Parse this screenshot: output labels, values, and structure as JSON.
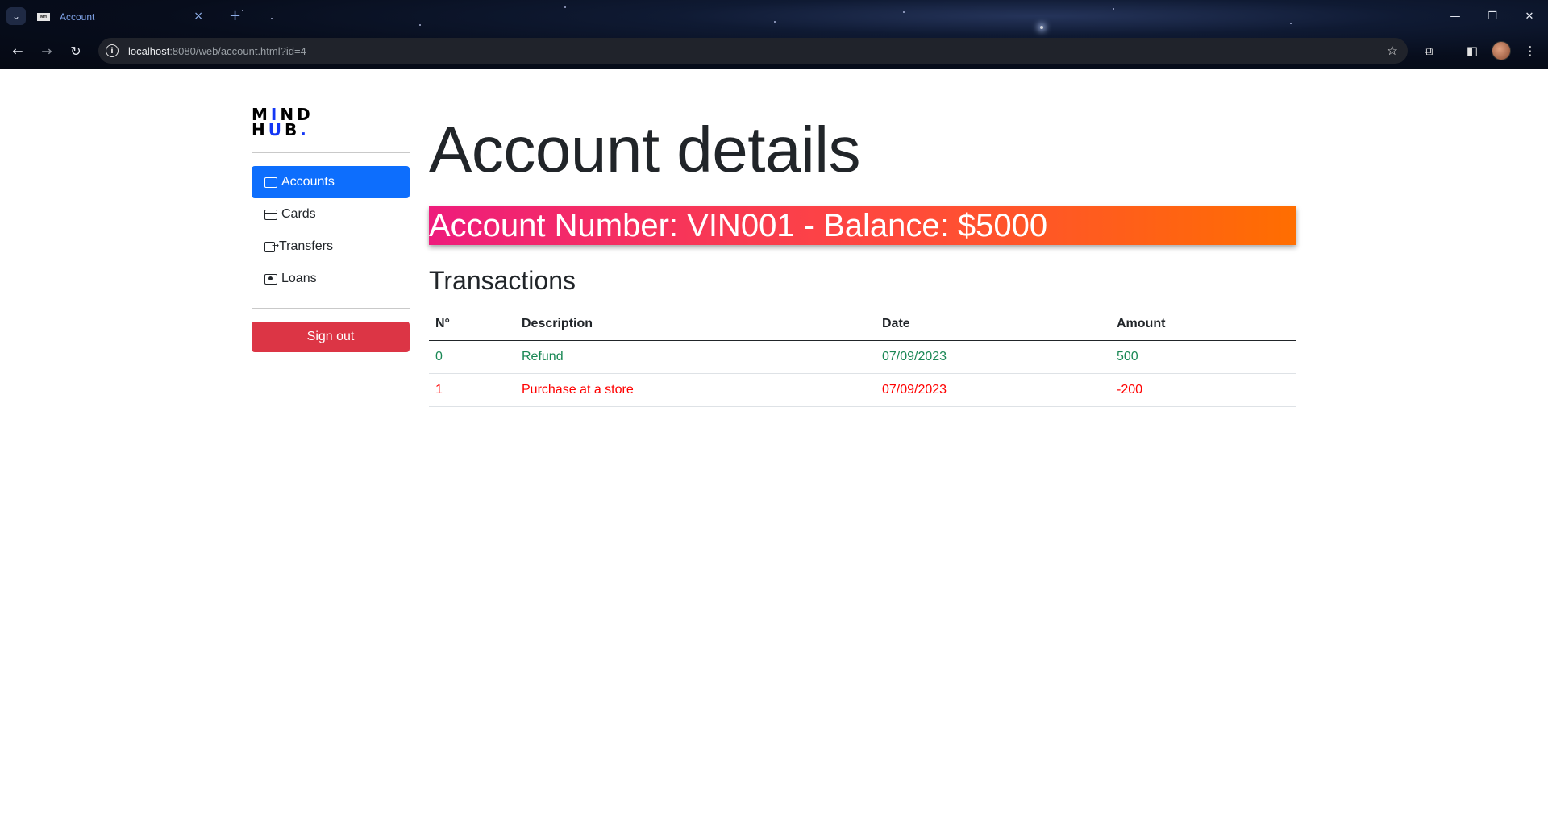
{
  "browser": {
    "tab_title": "Account",
    "url_host": "localhost",
    "url_rest": ":8080/web/account.html?id=4",
    "tab_close": "×",
    "tab_new": "+",
    "icons": {
      "menu": "chevron-down-icon",
      "back": "back-arrow-icon",
      "forward": "forward-arrow-icon",
      "reload": "reload-icon",
      "info": "info-icon",
      "bookmark": "star-icon",
      "extensions": "puzzle-icon",
      "sidepanel": "side-panel-icon",
      "more": "more-vert-icon"
    }
  },
  "sidebar": {
    "logo_line1": "MIND",
    "logo_line2": "HUB.",
    "items": [
      {
        "label": "Accounts",
        "icon": "inbox-icon",
        "active": true
      },
      {
        "label": "Cards",
        "icon": "credit-card-icon",
        "active": false
      },
      {
        "label": "Transfers",
        "icon": "transfer-icon",
        "active": false
      },
      {
        "label": "Loans",
        "icon": "cash-icon",
        "active": false
      }
    ],
    "signout_label": "Sign out"
  },
  "main": {
    "title": "Account details",
    "banner": "Account Number: VIN001 - Balance: $5000",
    "transactions_title": "Transactions",
    "columns": [
      "N°",
      "Description",
      "Date",
      "Amount"
    ],
    "rows": [
      {
        "n": "0",
        "description": "Refund",
        "date": "07/09/2023",
        "amount": "500",
        "type": "credit"
      },
      {
        "n": "1",
        "description": "Purchase at a store",
        "date": "07/09/2023",
        "amount": "-200",
        "type": "debit"
      }
    ]
  },
  "colors": {
    "primary": "#0d6efd",
    "danger": "#dc3545",
    "credit": "#198754",
    "debit": "#ff0000",
    "banner_start": "#ee1c7c",
    "banner_end": "#ff6e00"
  }
}
